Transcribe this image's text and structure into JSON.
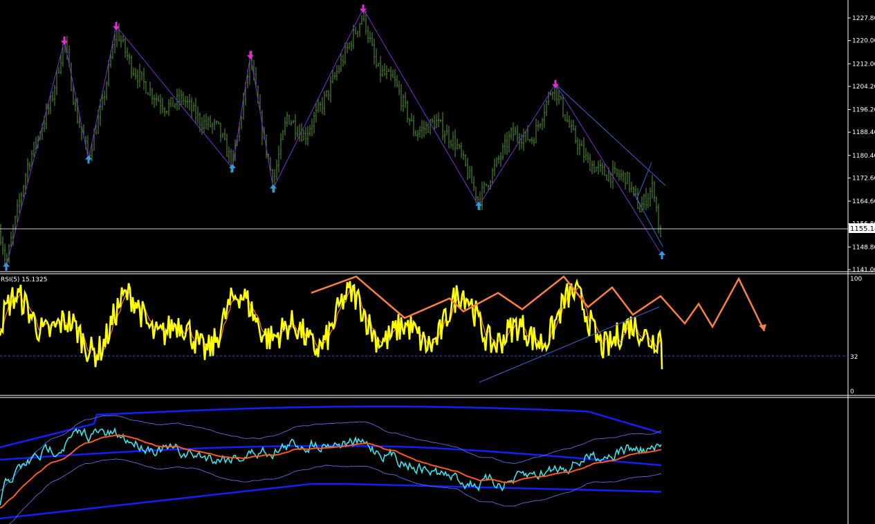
{
  "colors": {
    "background": "#000000",
    "frame": "#ffffff",
    "candle": "#4f9a2a",
    "zigzag": "#7b2bd6",
    "channel": "#3f63d6",
    "arrow_up": "#2f9be8",
    "arrow_down": "#e52bd6",
    "rsi": "#ffff00",
    "rsi_signal": "#ff7f32",
    "level_line": "#2a5fd0",
    "projection": "#ff8040",
    "bb_outer": "#1020ff",
    "bb_inner": "#5b6de0",
    "bb_price": "#38e6ee",
    "bb_mid": "#ff5a1a"
  },
  "price_panel": {
    "price_axis_labels": [
      "1227.80",
      "1220.00",
      "1212.00",
      "1204.20",
      "1196.20",
      "1188.40",
      "1180.40",
      "1172.60",
      "1164.60",
      "1156.80",
      "1148.80",
      "1141.00"
    ],
    "current_price_tag": "1155.14"
  },
  "rsi_panel": {
    "label": "RSI(5) 15.1325",
    "axis_labels": [
      "100",
      "32",
      "0"
    ]
  },
  "chart_data": [
    {
      "type": "line",
      "name": "price",
      "ylim": [
        1140,
        1230
      ],
      "x": [
        0,
        9,
        24,
        40,
        60,
        75,
        93,
        110,
        128,
        148,
        168,
        190,
        215,
        240,
        265,
        290,
        315,
        336,
        350,
        362,
        378,
        395,
        415,
        440,
        470,
        500,
        525,
        545,
        570,
        600,
        630,
        660,
        692,
        715,
        740,
        770,
        800,
        825,
        850,
        875,
        905,
        925,
        945,
        957
      ],
      "y": [
        1154,
        1143,
        1160,
        1177,
        1190,
        1200,
        1220,
        1195,
        1180,
        1198,
        1224,
        1211,
        1203,
        1197,
        1200,
        1192,
        1190,
        1177,
        1196,
        1214,
        1190,
        1171,
        1194,
        1187,
        1200,
        1216,
        1229,
        1210,
        1206,
        1188,
        1192,
        1184,
        1165,
        1176,
        1188,
        1186,
        1205,
        1189,
        1178,
        1174,
        1173,
        1162,
        1170,
        1147
      ],
      "last": 1155.14
    },
    {
      "type": "scatter",
      "name": "fractal arrows",
      "points": [
        {
          "x": 9,
          "y": 1142,
          "dir": "up"
        },
        {
          "x": 93,
          "y": 1220,
          "dir": "down"
        },
        {
          "x": 128,
          "y": 1179,
          "dir": "up"
        },
        {
          "x": 168,
          "y": 1225,
          "dir": "down"
        },
        {
          "x": 336,
          "y": 1176,
          "dir": "up"
        },
        {
          "x": 362,
          "y": 1215,
          "dir": "down"
        },
        {
          "x": 395,
          "y": 1169,
          "dir": "up"
        },
        {
          "x": 525,
          "y": 1231,
          "dir": "down"
        },
        {
          "x": 692,
          "y": 1163,
          "dir": "up"
        },
        {
          "x": 803,
          "y": 1205,
          "dir": "down"
        },
        {
          "x": 957,
          "y": 1146,
          "dir": "up"
        }
      ]
    },
    {
      "type": "line",
      "name": "RSI(5)",
      "ylim": [
        0,
        100
      ],
      "level": 32,
      "last": 15.1325
    },
    {
      "type": "line",
      "name": "projection",
      "x": [
        450,
        515,
        585,
        650,
        670,
        720,
        755,
        815,
        850,
        885,
        915,
        955,
        990,
        1010,
        1030,
        1068,
        1105
      ],
      "y": [
        85,
        100,
        62,
        80,
        68,
        85,
        70,
        100,
        72,
        90,
        65,
        82,
        57,
        75,
        54,
        98,
        50
      ]
    }
  ]
}
